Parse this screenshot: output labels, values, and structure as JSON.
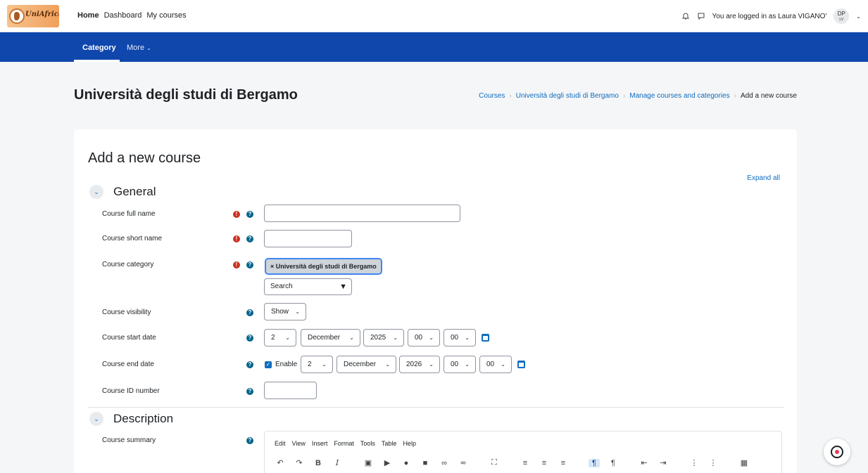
{
  "brand": {
    "logo_text": "UniAfrica"
  },
  "primary_nav": {
    "home": "Home",
    "dashboard": "Dashboard",
    "my_courses": "My courses"
  },
  "user": {
    "logged_in_text": "You are logged in as Laura VIGANO'",
    "avatar_initials": "DP",
    "avatar_sub": "LV"
  },
  "secondary_nav": {
    "category": "Category",
    "more": "More"
  },
  "page": {
    "title": "Università degli studi di Bergamo"
  },
  "breadcrumb": {
    "items": [
      "Courses",
      "Università degli studi di Bergamo",
      "Manage courses and categories"
    ],
    "current": "Add a new course"
  },
  "form": {
    "title": "Add a new course",
    "expand_all": "Expand all",
    "general": {
      "heading": "General",
      "full_name_label": "Course full name",
      "short_name_label": "Course short name",
      "category_label": "Course category",
      "category_chip": "× Università degli studi di Bergamo",
      "category_search": "Search",
      "visibility_label": "Course visibility",
      "visibility_value": "Show",
      "start_label": "Course start date",
      "start": {
        "day": "2",
        "month": "December",
        "year": "2025",
        "hour": "00",
        "minute": "00"
      },
      "end_label": "Course end date",
      "end_enable": "Enable",
      "end": {
        "day": "2",
        "month": "December",
        "year": "2026",
        "hour": "00",
        "minute": "00"
      },
      "id_label": "Course ID number"
    },
    "description": {
      "heading": "Description",
      "summary_label": "Course summary",
      "menu": [
        "Edit",
        "View",
        "Insert",
        "Format",
        "Tools",
        "Table",
        "Help"
      ]
    }
  },
  "colors": {
    "primary_blue": "#0f47ad",
    "link": "#0f6cbf",
    "required": "#ca3120",
    "help": "#00648a"
  }
}
